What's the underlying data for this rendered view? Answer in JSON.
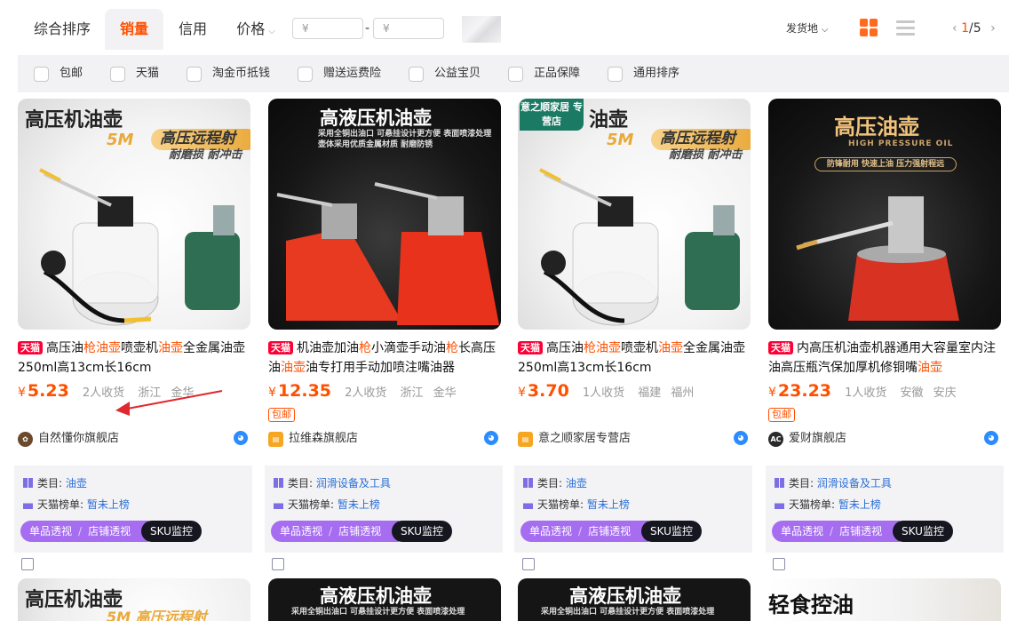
{
  "sort_tabs": [
    {
      "label": "综合排序",
      "active": false
    },
    {
      "label": "销量",
      "active": true
    },
    {
      "label": "信用",
      "active": false
    },
    {
      "label": "价格",
      "active": false
    }
  ],
  "price_filter": {
    "min_placeholder": "¥",
    "max_placeholder": "¥",
    "dash": "-"
  },
  "ship_from": "发货地",
  "pager": {
    "current": "1",
    "total": "/5"
  },
  "filters": [
    "包邮",
    "天猫",
    "淘金币抵钱",
    "赠送运费险",
    "公益宝贝",
    "正品保障",
    "通用排序"
  ],
  "products": [
    {
      "image_headline": "高压机油壶",
      "image_tag": "5M",
      "image_slogan": "高压远程射",
      "image_sub": "耐磨损 耐冲击",
      "image_store_tag": "",
      "platform": "天猫",
      "title_parts": [
        {
          "t": "高压油",
          "hl": false
        },
        {
          "t": "枪",
          "hl": true
        },
        {
          "t": "油壶",
          "hl": true
        },
        {
          "t": "喷壶机",
          "hl": false
        },
        {
          "t": "油壶",
          "hl": true
        },
        {
          "t": "全金属油壶250ml高13cm长16cm",
          "hl": false
        }
      ],
      "price": "5.23",
      "currency": "¥",
      "sold": "2人收货",
      "province": "浙江",
      "city": "金华",
      "free_shipping": "",
      "shop": "自然懂你旗舰店",
      "category_label": "类目:",
      "category": "油壶",
      "rank_label": "天猫榜单:",
      "rank": "暂未上榜"
    },
    {
      "image_headline": "高液压机油壶",
      "image_tag": "",
      "image_slogan": "采用全铜出油口 可悬挂设计更方便 表面喷漆处理",
      "image_sub": "壶体采用优质金属材质 耐磨防锈",
      "image_store_tag": "",
      "platform": "天猫",
      "title_parts": [
        {
          "t": "机油壶加油",
          "hl": false
        },
        {
          "t": "枪",
          "hl": true
        },
        {
          "t": "小滴壶手动油",
          "hl": false
        },
        {
          "t": "枪",
          "hl": true
        },
        {
          "t": "长高压油",
          "hl": false
        },
        {
          "t": "油壶",
          "hl": true
        },
        {
          "t": "油专打用手动加喷注嘴油器",
          "hl": false
        }
      ],
      "price": "12.35",
      "currency": "¥",
      "sold": "2人收货",
      "province": "浙江",
      "city": "金华",
      "free_shipping": "包邮",
      "shop": "拉维森旗舰店",
      "category_label": "类目:",
      "category": "润滑设备及工具",
      "rank_label": "天猫榜单:",
      "rank": "暂未上榜"
    },
    {
      "image_headline": "油壶",
      "image_tag": "5M",
      "image_slogan": "高压远程射",
      "image_sub": "耐磨损 耐冲击",
      "image_store_tag": "意之顺家居 专营店",
      "platform": "天猫",
      "title_parts": [
        {
          "t": "高压油",
          "hl": false
        },
        {
          "t": "枪",
          "hl": true
        },
        {
          "t": "油壶",
          "hl": true
        },
        {
          "t": "喷壶机",
          "hl": false
        },
        {
          "t": "油壶",
          "hl": true
        },
        {
          "t": "全金属油壶250ml高13cm长16cm",
          "hl": false
        }
      ],
      "price": "3.70",
      "currency": "¥",
      "sold": "1人收货",
      "province": "福建",
      "city": "福州",
      "free_shipping": "",
      "shop": "意之顺家居专营店",
      "category_label": "类目:",
      "category": "油壶",
      "rank_label": "天猫榜单:",
      "rank": "暂未上榜"
    },
    {
      "image_headline": "高压油壶",
      "image_tag": "HIGH PRESSURE OIL",
      "image_slogan": "防锋耐用 快速上油 压力强射程远",
      "image_sub": "",
      "image_store_tag": "",
      "platform": "天猫",
      "title_parts": [
        {
          "t": "内高压机油壶机器通用大容量室内注油高压瓶汽保加厚机修铜嘴",
          "hl": false
        },
        {
          "t": "油壶",
          "hl": true
        }
      ],
      "price": "23.23",
      "currency": "¥",
      "sold": "1人收货",
      "province": "安徽",
      "city": "安庆",
      "free_shipping": "包邮",
      "shop": "爱财旗舰店",
      "category_label": "类目:",
      "category": "润滑设备及工具",
      "rank_label": "天猫榜单:",
      "rank": "暂未上榜"
    }
  ],
  "analytics_buttons": {
    "single": "单品透视",
    "shop": "店铺透视",
    "sku": "SKU监控"
  },
  "next_row_headlines": [
    "高压机油壶",
    "高液压机油壶",
    "高液压机油壶",
    "轻食控油"
  ],
  "next_row_sub": [
    "5M 高压远程射",
    "采用全铜出油口 可悬挂设计更方便 表面喷漆处理",
    "采用全铜出油口 可悬挂设计更方便 表面喷漆处理",
    ""
  ],
  "colors": {
    "accent": "#ff5000",
    "tmall": "#ff0036",
    "link": "#2b6fd6",
    "purple": "#a66df0"
  }
}
